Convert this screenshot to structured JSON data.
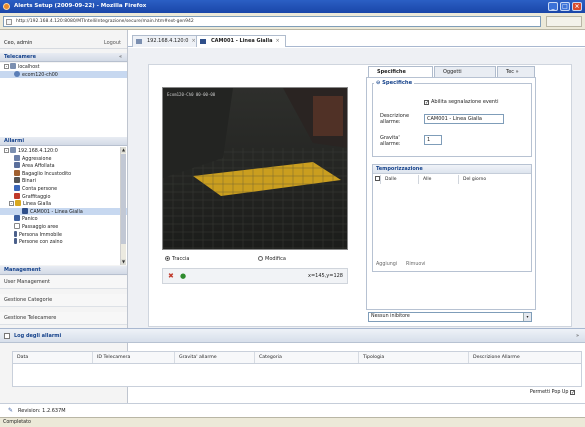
{
  "window": {
    "title": "Alerts Setup (2009-09-22) - Mozilla Firefox"
  },
  "address": {
    "url": "http://192.168.4.120:8080/MTIntelliIntegrazione/secure/main.htm#ext-gen942"
  },
  "user": {
    "name": "Ceo, admin",
    "logout": "Logout"
  },
  "telecamere": {
    "title": "Telecamere",
    "nodes": [
      "localhost",
      "ecom120-ch00"
    ]
  },
  "allarmi": {
    "title": "Allarmi",
    "nodes": [
      "192.168.4.120:0",
      "Aggressione",
      "Area Affollata",
      "Bagaglio Incustodito",
      "Binari",
      "Conta persone",
      "Graffitaggio",
      "Linea Gialla",
      "CAM001 - Linea Gialla",
      "Panico",
      "Passaggio aree",
      "Persona Immobile",
      "Persone con zaino"
    ]
  },
  "management": {
    "title": "Management",
    "items": [
      "User Management",
      "Gestione Categorie",
      "Gestione Telecamere"
    ]
  },
  "tabs": [
    {
      "label": "192.168.4.120:0"
    },
    {
      "label": "CAM001 - Linea Gialla"
    }
  ],
  "camera": {
    "overlay_text": "Ecom120-Ch0 00-00-00",
    "mode_traccia": "Traccia",
    "mode_modifica": "Modifica",
    "coords": "x=145,y=128"
  },
  "right_tabs": [
    "Specifiche",
    "Oggetti",
    "Tec"
  ],
  "specifiche": {
    "legend": "Specifiche",
    "enable_label": "Abilita segnalazione eventi",
    "descr_label_1": "Descrizione",
    "descr_label_2": "allarme:",
    "descr_value": "CAM001 - Linea Gialla",
    "gravity_label_1": "Gravita'",
    "gravity_label_2": "allarme:",
    "gravity_value": "1"
  },
  "temporizzazione": {
    "title": "Temporizzazione",
    "columns": [
      "Dalle",
      "Alle",
      "Del giorno"
    ],
    "add": "Aggiungi",
    "remove": "Rimuovi"
  },
  "inhibitor": {
    "value": "Nessun inibitore"
  },
  "log": {
    "title": "Log degli allarmi",
    "columns": [
      "Data",
      "ID Telecamera",
      "Gravita' allarme",
      "Categoria",
      "Tipologia",
      "Descrizione Allarme"
    ],
    "popup_label": "Permetti Pop Up"
  },
  "revision": "Revision: 1.2.637M",
  "status": "Completato",
  "colors": {
    "accent": "#15428b",
    "zone": "#e8b41f",
    "title_bar": "#2b5fc4"
  }
}
